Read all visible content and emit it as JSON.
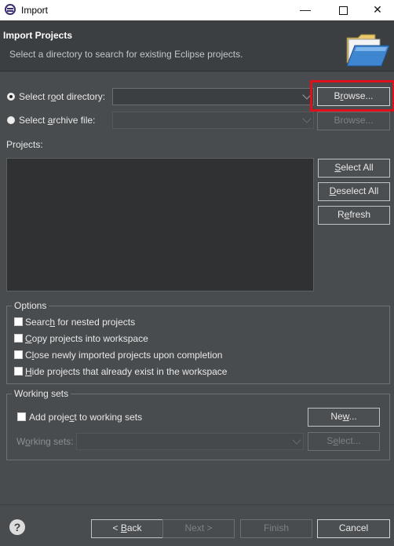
{
  "window": {
    "title": "Import",
    "minimize_glyph": "—",
    "close_glyph": "✕"
  },
  "header": {
    "title": "Import Projects",
    "description": "Select a directory to search for existing Eclipse projects."
  },
  "source": {
    "root_directory_label": "Select root directory:",
    "root_directory_value": "",
    "root_directory_selected": true,
    "browse_root_label": "Browse...",
    "archive_file_label": "Select archive file:",
    "archive_file_value": "",
    "archive_file_selected": false,
    "browse_archive_label": "Browse..."
  },
  "projects": {
    "label": "Projects:",
    "items": [],
    "select_all_label": "Select All",
    "deselect_all_label": "Deselect All",
    "refresh_label": "Refresh"
  },
  "options": {
    "title": "Options",
    "items": [
      {
        "label": "Search for nested projects",
        "checked": false
      },
      {
        "label": "Copy projects into workspace",
        "checked": false
      },
      {
        "label": "Close newly imported projects upon completion",
        "checked": false
      },
      {
        "label": "Hide projects that already exist in the workspace",
        "checked": false
      }
    ]
  },
  "working_sets": {
    "title": "Working sets",
    "add_label": "Add project to working sets",
    "add_checked": false,
    "new_label": "New...",
    "sets_label": "Working sets:",
    "sets_value": "",
    "select_label": "Select..."
  },
  "footer": {
    "help_glyph": "?",
    "back_label": "< Back",
    "next_label": "Next >",
    "finish_label": "Finish",
    "cancel_label": "Cancel"
  },
  "colors": {
    "background": "#484c4f",
    "header": "#3b3f42",
    "highlight": "#e0101a"
  }
}
